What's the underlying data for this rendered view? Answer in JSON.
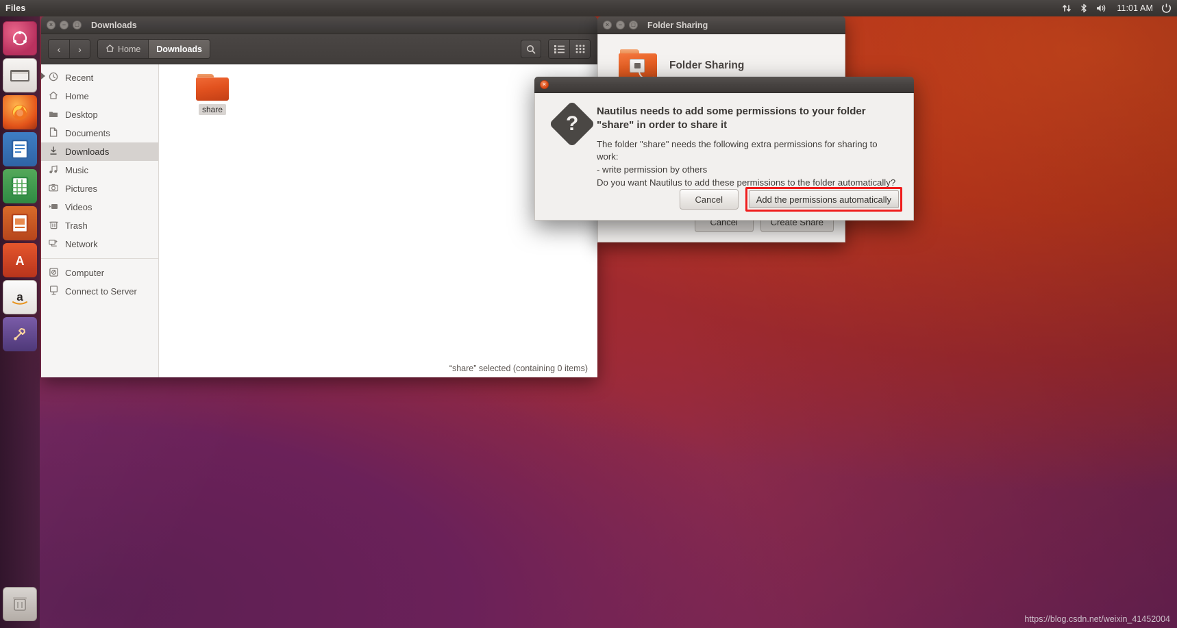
{
  "panel": {
    "app_name": "Files",
    "clock": "11:01 AM",
    "tray": [
      {
        "name": "network-icon",
        "glyph": "⇅"
      },
      {
        "name": "bluetooth-icon",
        "glyph": "✳"
      },
      {
        "name": "volume-icon",
        "glyph": "🔊"
      }
    ],
    "session_icon": "⚙"
  },
  "launcher": {
    "items": [
      {
        "name": "ubuntu-dash",
        "label": "Ubuntu Dash",
        "glyph": "◉"
      },
      {
        "name": "files",
        "label": "Files",
        "glyph": "🗄"
      },
      {
        "name": "firefox",
        "label": "Firefox",
        "glyph": "🦊"
      },
      {
        "name": "libreoffice-writer",
        "label": "LibreOffice Writer",
        "glyph": "📄"
      },
      {
        "name": "libreoffice-calc",
        "label": "LibreOffice Calc",
        "glyph": "▦"
      },
      {
        "name": "libreoffice-impress",
        "label": "LibreOffice Impress",
        "glyph": "▤"
      },
      {
        "name": "ubuntu-software",
        "label": "Ubuntu Software",
        "glyph": "A"
      },
      {
        "name": "amazon",
        "label": "Amazon",
        "glyph": "a"
      },
      {
        "name": "system-settings",
        "label": "System Settings",
        "glyph": "🔧"
      }
    ],
    "trash": {
      "name": "trash",
      "label": "Trash",
      "glyph": "🗑"
    }
  },
  "nautilus": {
    "title": "Downloads",
    "window_buttons": {
      "close": "×",
      "minimize": "−",
      "maximize": "□"
    },
    "nav": {
      "back": "‹",
      "forward": "›"
    },
    "breadcrumbs": [
      {
        "label": "Home",
        "icon": "home-icon",
        "current": false
      },
      {
        "label": "Downloads",
        "icon": "",
        "current": true
      }
    ],
    "toolbar": {
      "search": "search-icon",
      "list_view": "list-view-icon",
      "grid_view": "grid-view-icon"
    },
    "sidebar": {
      "groups": [
        [
          {
            "label": "Recent",
            "icon": "clock-icon",
            "selected": false
          },
          {
            "label": "Home",
            "icon": "home-icon",
            "selected": false
          },
          {
            "label": "Desktop",
            "icon": "folder-icon",
            "selected": false
          },
          {
            "label": "Documents",
            "icon": "document-icon",
            "selected": false
          },
          {
            "label": "Downloads",
            "icon": "download-icon",
            "selected": true
          },
          {
            "label": "Music",
            "icon": "music-icon",
            "selected": false
          },
          {
            "label": "Pictures",
            "icon": "camera-icon",
            "selected": false
          },
          {
            "label": "Videos",
            "icon": "video-icon",
            "selected": false
          },
          {
            "label": "Trash",
            "icon": "trash-icon",
            "selected": false
          },
          {
            "label": "Network",
            "icon": "network-icon",
            "selected": false
          }
        ],
        [
          {
            "label": "Computer",
            "icon": "disk-icon",
            "selected": false
          },
          {
            "label": "Connect to Server",
            "icon": "server-icon",
            "selected": false
          }
        ]
      ]
    },
    "files": [
      {
        "name": "share",
        "type": "folder",
        "selected": true
      }
    ],
    "status": "“share” selected  (containing 0 items)"
  },
  "folder_sharing": {
    "title": "Folder Sharing",
    "heading": "Folder Sharing",
    "window_buttons": {
      "close": "×",
      "minimize": "−",
      "maximize": "□"
    },
    "buttons": [
      {
        "label": "Cancel",
        "name": "cancel-button"
      },
      {
        "label": "Create Share",
        "name": "create-share-button"
      }
    ]
  },
  "permission_dialog": {
    "window_buttons": {
      "close": "×"
    },
    "icon": "question-icon",
    "heading": "Nautilus needs to add some permissions to your folder \"share\" in order to share it",
    "body": "The folder \"share\" needs the following extra permissions for sharing to work:\n - write permission by others\nDo you want Nautilus to add these permissions to the folder automatically?",
    "buttons": [
      {
        "label": "Cancel",
        "name": "cancel-button",
        "highlighted": false
      },
      {
        "label": "Add the permissions automatically",
        "name": "add-permissions-button",
        "highlighted": true
      }
    ],
    "highlight_color": "#ef1d1d"
  },
  "watermark": "https://blog.csdn.net/weixin_41452004"
}
